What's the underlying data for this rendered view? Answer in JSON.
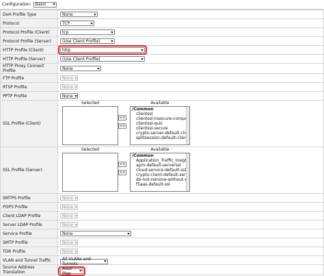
{
  "config": {
    "label": "Configuration:",
    "value": "Basic"
  },
  "rows": {
    "doh": {
      "label": "DoH Profile Type",
      "value": "None"
    },
    "protocol": {
      "label": "Protocol",
      "value": "TCP"
    },
    "prot_client": {
      "label": "Protocol Profile (Client)",
      "value": "tcp"
    },
    "prot_server": {
      "label": "Protocol Profile (Server)",
      "value": "(Use Client Profile)"
    },
    "http_client": {
      "label": "HTTP Profile (Client)",
      "value": "http"
    },
    "http_server": {
      "label": "HTTP Profile (Server)",
      "value": "(Use Client Profile)"
    },
    "http_proxy": {
      "label": "HTTP Proxy Connect Profile",
      "value": "None"
    },
    "ftp": {
      "label": "FTP Profile",
      "value": "None"
    },
    "rtsp": {
      "label": "RTSP Profile",
      "value": "None"
    },
    "pptp": {
      "label": "PPTP Profile",
      "value": "None"
    },
    "ssl_client": {
      "label": "SSL Profile (Client)"
    },
    "ssl_server": {
      "label": "SSL Profile (Server)"
    },
    "smtps": {
      "label": "SMTPS Profile",
      "value": "None"
    },
    "pop3": {
      "label": "POP3 Profile",
      "value": "None"
    },
    "client_ldap": {
      "label": "Client LDAP Profile",
      "value": "None"
    },
    "server_ldap": {
      "label": "Server LDAP Profile",
      "value": "None"
    },
    "service": {
      "label": "Service Profile",
      "value": "None"
    },
    "smtp": {
      "label": "SMTP Profile",
      "value": "None"
    },
    "tdr": {
      "label": "TDR Profile",
      "value": "None"
    },
    "vlan": {
      "label": "VLAN and Tunnel Traffic",
      "value": "All VLANs and Tunnels"
    },
    "snat": {
      "label": "Source Address Translation",
      "value": "Auto Map"
    }
  },
  "ssl_client": {
    "selected_label": "Selected",
    "available_label": "Available",
    "move_left": "<<",
    "move_right": ">>",
    "group": "/Common",
    "items": [
      "clientssl",
      "clientssl-insecure-compatible",
      "clientssl-quic",
      "clientssl-secure",
      "crypto-server-default-clientssl",
      "splitsession-default-clientssl"
    ]
  },
  "ssl_server": {
    "selected_label": "Selected",
    "available_label": "Available",
    "move_left": "<<",
    "move_right": ">>",
    "group": "/Common",
    "items": [
      "Application_Traffic_Insight_serverssl",
      "apm-default-serverssl",
      "cloud-service-default-ssl",
      "crypto-client-default-serverssl",
      "do-not-remove-without-replacement",
      "f5aas-default-ssl"
    ]
  }
}
